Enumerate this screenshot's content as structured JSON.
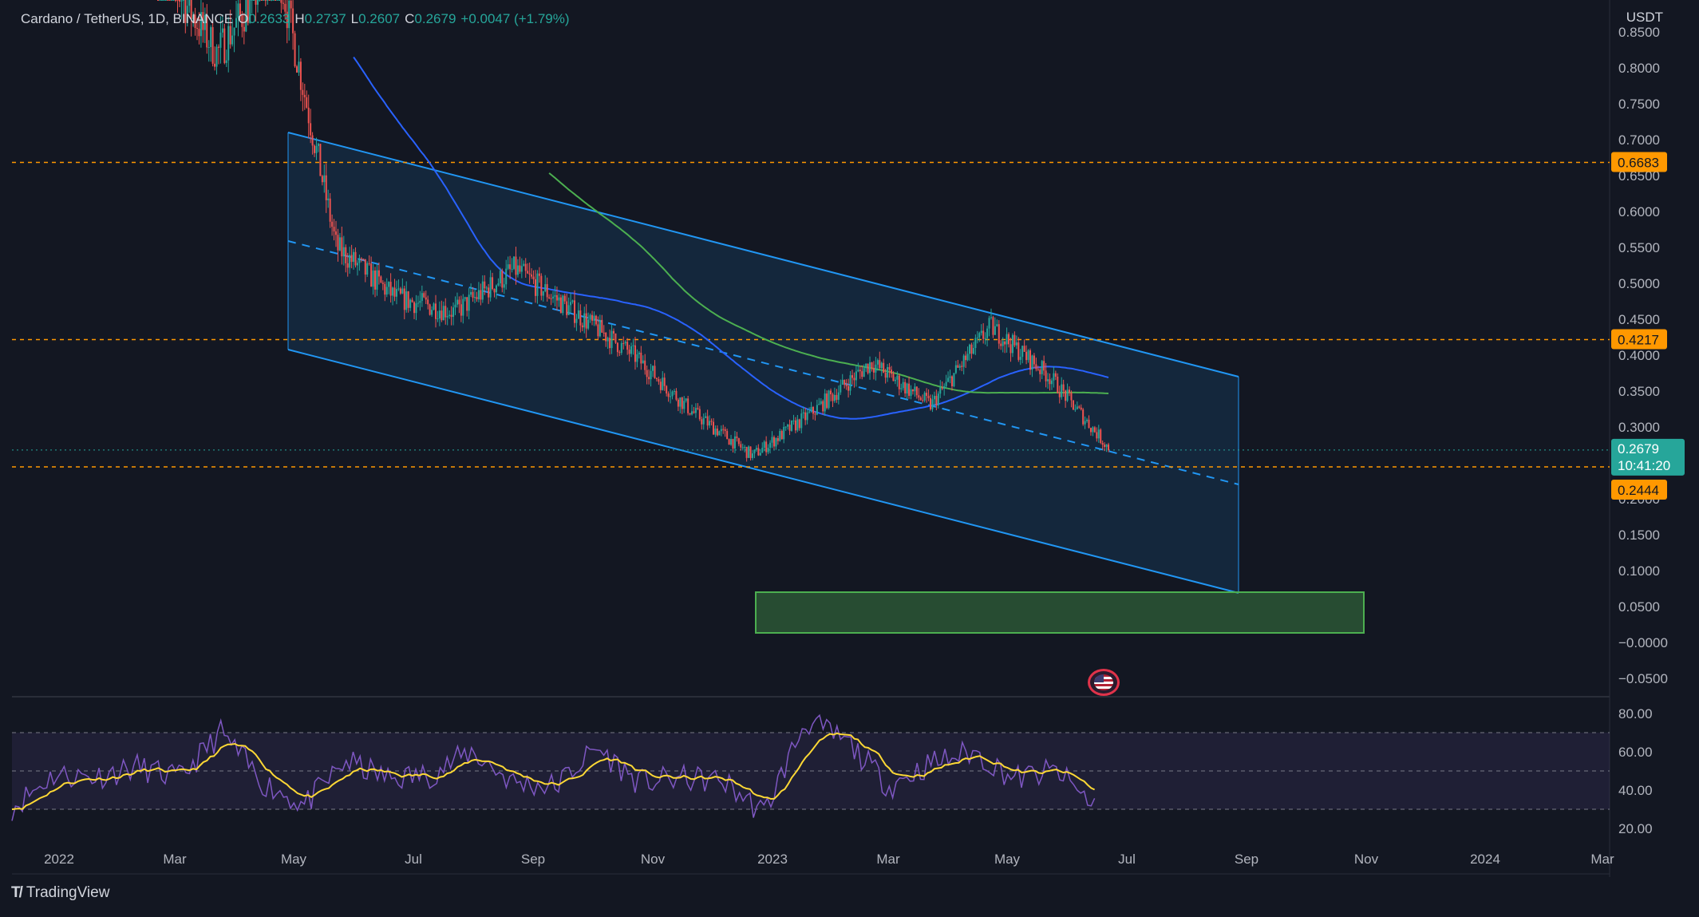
{
  "header": {
    "symbol": "Cardano / TetherUS, 1D, BINANCE",
    "open_label": "O",
    "open": "0.2633",
    "high_label": "H",
    "high": "0.2737",
    "low_label": "L",
    "low": "0.2607",
    "close_label": "C",
    "close": "0.2679",
    "change": "+0.0047 (+1.79%)"
  },
  "currency": "USDT",
  "brand": "TradingView",
  "colors": {
    "background": "#131722",
    "up": "#26a69a",
    "down": "#ef5350",
    "channel": "#2196f3",
    "ma_blue": "#2962ff",
    "ma_green": "#4caf50",
    "level": "#ff9800",
    "rsi": "#7e57c2",
    "rsi_ma": "#fdd835",
    "zone": "#4caf50"
  },
  "chart_data": {
    "type": "candlestick",
    "symbol": "ADAUSDT",
    "interval": "1D",
    "y_axis": {
      "ticks": [
        "0.8500",
        "0.8000",
        "0.7500",
        "0.7000",
        "0.6500",
        "0.6000",
        "0.5500",
        "0.5000",
        "0.4500",
        "0.4000",
        "0.3500",
        "0.3000",
        "0.2500",
        "0.2000",
        "0.1500",
        "0.1000",
        "0.0500",
        "−0.0000",
        "−0.0500"
      ],
      "range": [
        -0.065,
        0.85
      ]
    },
    "x_axis": {
      "ticks": [
        "2022",
        "Mar",
        "May",
        "Jul",
        "Sep",
        "Nov",
        "2023",
        "Mar",
        "May",
        "Jul",
        "Sep",
        "Nov",
        "2024",
        "Mar"
      ]
    },
    "price_labels": [
      {
        "value": "0.6683",
        "kind": "level"
      },
      {
        "value": "0.4217",
        "kind": "level"
      },
      {
        "value": "0.2679",
        "kind": "last",
        "countdown": "10:41:20"
      },
      {
        "value": "0.2444",
        "kind": "level"
      }
    ],
    "horizontal_levels": [
      0.6683,
      0.4217,
      0.2444
    ],
    "price_path_monthly": [
      {
        "date": "Feb 2022",
        "price": 0.95
      },
      {
        "date": "Mar 2022",
        "price": 0.82
      },
      {
        "date": "Apr 2022",
        "price": 0.95
      },
      {
        "date": "May 2022",
        "price": 0.55
      },
      {
        "date": "Jun 2022",
        "price": 0.48
      },
      {
        "date": "Jul 2022",
        "price": 0.46
      },
      {
        "date": "Aug 2022",
        "price": 0.52
      },
      {
        "date": "Sep 2022",
        "price": 0.46
      },
      {
        "date": "Oct 2022",
        "price": 0.4
      },
      {
        "date": "Nov 2022",
        "price": 0.32
      },
      {
        "date": "Dec 2022",
        "price": 0.26
      },
      {
        "date": "Jan 2023",
        "price": 0.32
      },
      {
        "date": "Feb 2023",
        "price": 0.39
      },
      {
        "date": "Mar 2023",
        "price": 0.33
      },
      {
        "date": "Apr 2023",
        "price": 0.44
      },
      {
        "date": "May 2023",
        "price": 0.37
      },
      {
        "date": "Jun 2023",
        "price": 0.27
      }
    ],
    "rsi": {
      "ticks": [
        "80.00",
        "60.00",
        "40.00",
        "20.00"
      ],
      "band": [
        30,
        70
      ],
      "series_monthly": [
        31,
        48,
        47,
        52,
        46,
        70,
        44,
        32,
        55,
        46,
        48,
        60,
        44,
        42,
        62,
        44,
        46,
        45,
        28,
        76,
        65,
        42,
        54,
        60,
        46,
        50,
        30
      ]
    }
  }
}
